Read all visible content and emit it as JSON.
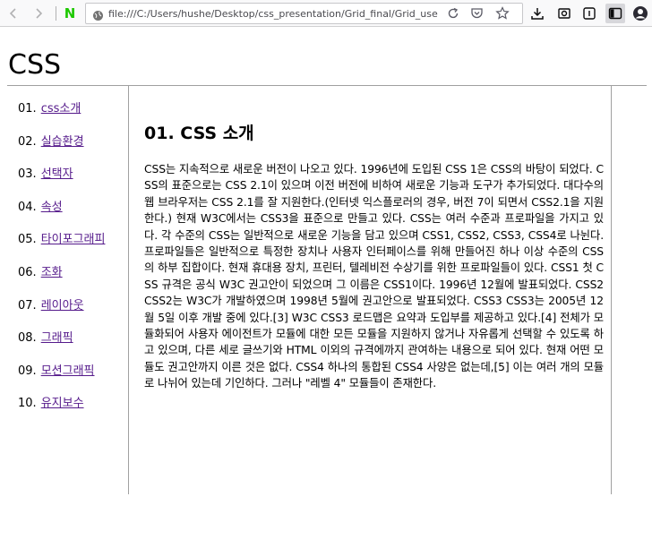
{
  "browser": {
    "url": "file:///C:/Users/hushe/Desktop/css_presentation/Grid_final/Grid_use",
    "icons": [
      "back-icon",
      "forward-icon",
      "naver-icon",
      "page-icon",
      "reload-icon",
      "pocket-icon",
      "bookmark-star-icon",
      "download-icon",
      "screenshot-icon",
      "reader-view-icon",
      "sidebar-icon",
      "account-icon"
    ],
    "naver_letter": "N"
  },
  "page": {
    "title": "CSS",
    "nav": [
      {
        "num": "01.",
        "label": "css소개"
      },
      {
        "num": "02.",
        "label": "실습환경"
      },
      {
        "num": "03.",
        "label": "선택자"
      },
      {
        "num": "04.",
        "label": "속성"
      },
      {
        "num": "05.",
        "label": "타이포그래피"
      },
      {
        "num": "06.",
        "label": "조화"
      },
      {
        "num": "07.",
        "label": "레이아웃"
      },
      {
        "num": "08.",
        "label": "그래픽"
      },
      {
        "num": "09.",
        "label": "모션그래픽"
      },
      {
        "num": "10.",
        "label": "유지보수"
      }
    ],
    "article": {
      "heading": "01. CSS 소개",
      "body": "CSS는 지속적으로 새로운 버전이 나오고 있다. 1996년에 도입된 CSS 1은 CSS의 바탕이 되었다. CSS의 표준으로는 CSS 2.1이 있으며 이전 버전에 비하여 새로운 기능과 도구가 추가되었다. 대다수의 웹 브라우저는 CSS 2.1를 잘 지원한다.(인터넷 익스플로러의 경우, 버전 7이 되면서 CSS2.1을 지원한다.) 현재 W3C에서는 CSS3을 표준으로 만들고 있다. CSS는 여러 수준과 프로파일을 가지고 있다. 각 수준의 CSS는 일반적으로 새로운 기능을 담고 있으며 CSS1, CSS2, CSS3, CSS4로 나뉜다. 프로파일들은 일반적으로 특정한 장치나 사용자 인터페이스를 위해 만들어진 하나 이상 수준의 CSS의 하부 집합이다. 현재 휴대용 장치, 프린터, 텔레비전 수상기를 위한 프로파일들이 있다. CSS1 첫 CSS 규격은 공식 W3C 권고안이 되었으며 그 이름은 CSS1이다. 1996년 12월에 발표되었다. CSS2 CSS2는 W3C가 개발하였으며 1998년 5월에 권고안으로 발표되었다. CSS3 CSS3는 2005년 12월 5일 이후 개발 중에 있다.[3] W3C CSS3 로드맵은 요약과 도입부를 제공하고 있다.[4] 전체가 모듈화되어 사용자 에이전트가 모듈에 대한 모든 모듈을 지원하지 않거나 자유롭게 선택할 수 있도록 하고 있으며, 다른 세로 글쓰기와 HTML 이외의 규격에까지 관여하는 내용으로 되어 있다. 현재 어떤 모듈도 권고안까지 이른 것은 없다. CSS4 하나의 통합된 CSS4 사양은 없는데,[5] 이는 여러 개의 모듈로 나뉘어 있는데 기인하다. 그러나 \"레벨 4\" 모듈들이 존재한다."
    }
  },
  "colors": {
    "link_visited": "#551a8b",
    "naver_green": "#1ec800",
    "toolbar_bg": "#f9f9fa",
    "rule": "#a0a0a0"
  }
}
